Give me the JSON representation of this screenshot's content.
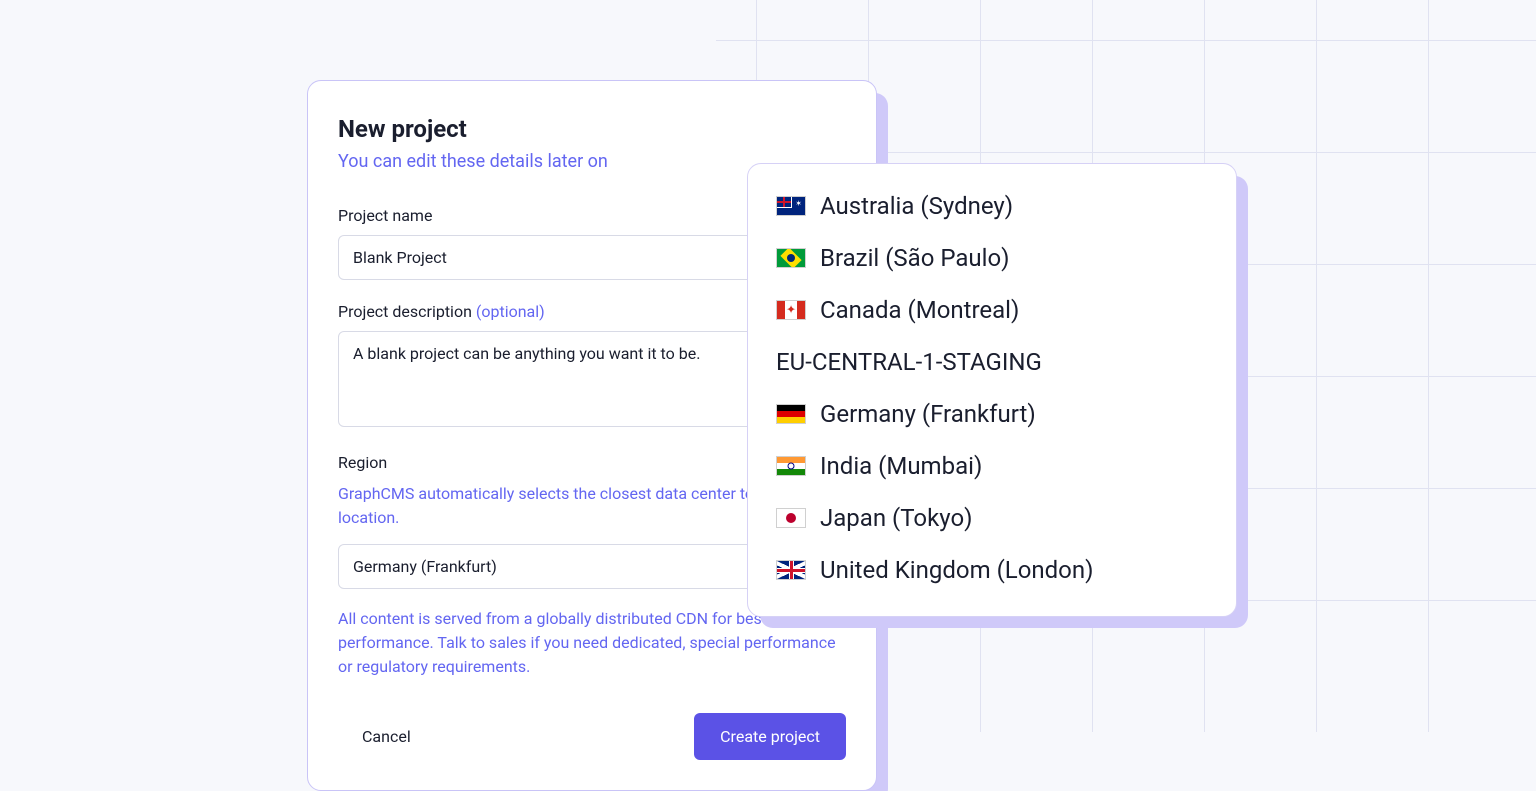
{
  "modal": {
    "title": "New project",
    "subtitle": "You can edit these details later on",
    "name_label": "Project name",
    "name_value": "Blank Project",
    "desc_label": "Project description",
    "desc_optional": "(optional)",
    "desc_value": "A blank project can be anything you want it to be.",
    "region_label": "Region",
    "region_help": "GraphCMS automatically selects the closest data center to your location.",
    "region_value": "Germany (Frankfurt)",
    "cdn_note_a": "All content is served from a globally distributed CDN for best delivery performance. ",
    "cdn_link": "Talk to sales",
    "cdn_note_b": " if you need dedicated, special performance or regulatory requirements.",
    "cancel": "Cancel",
    "create": "Create project"
  },
  "dropdown": {
    "items": [
      {
        "flag": "flag-au",
        "label": "Australia (Sydney)"
      },
      {
        "flag": "flag-br",
        "label": "Brazil (São Paulo)"
      },
      {
        "flag": "flag-ca",
        "label": "Canada (Montreal)"
      },
      {
        "flag": "",
        "label": "EU-CENTRAL-1-STAGING"
      },
      {
        "flag": "flag-de",
        "label": "Germany (Frankfurt)"
      },
      {
        "flag": "flag-in",
        "label": "India (Mumbai)"
      },
      {
        "flag": "flag-jp",
        "label": "Japan (Tokyo)"
      },
      {
        "flag": "flag-gb",
        "label": "United Kingdom (London)"
      }
    ]
  }
}
